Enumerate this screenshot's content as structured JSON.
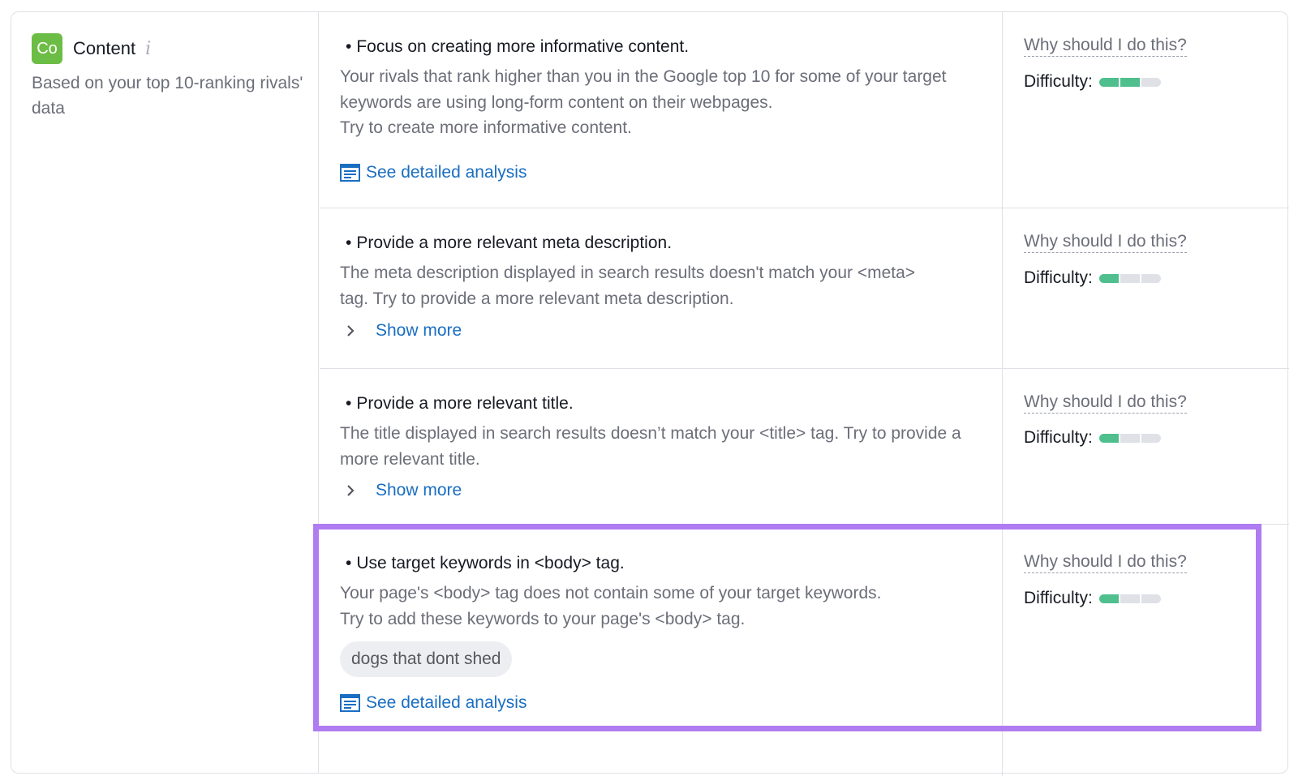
{
  "category": {
    "badge": "Co",
    "title": "Content",
    "info_icon": "info-icon",
    "description": "Based on your top 10-ranking rivals' data"
  },
  "colors": {
    "badge": "#6cbd45",
    "link": "#1a6ec2",
    "difficulty_fill": "#4fbf8e",
    "highlight": "#b07cf2"
  },
  "ideas": [
    {
      "title": "Focus on creating more informative content.",
      "description": "Your rivals that rank higher than you in the Google top 10 for some of your target keywords are using long-form content on their webpages.\nTry to create more informative content.",
      "link": "See detailed analysis",
      "why": "Why should I do this?",
      "difficulty_label": "Difficulty:",
      "difficulty_level": 2,
      "difficulty_max": 3
    },
    {
      "title": "Provide a more relevant meta description.",
      "description": "The meta description displayed in search results doesn't match your <meta> tag. Try to provide a more relevant meta description.",
      "link": "Show more",
      "why": "Why should I do this?",
      "difficulty_label": "Difficulty:",
      "difficulty_level": 1,
      "difficulty_max": 3
    },
    {
      "title": "Provide a more relevant title.",
      "description": "The title displayed in search results doesn’t match your <title> tag. Try to provide a more relevant title.",
      "link": "Show more",
      "why": "Why should I do this?",
      "difficulty_label": "Difficulty:",
      "difficulty_level": 1,
      "difficulty_max": 3
    },
    {
      "title": "Use target keywords in <body> tag.",
      "description": "Your page's <body> tag does not contain some of your target keywords.\nTry to add these keywords to your page's <body> tag.",
      "keyword": "dogs that dont shed",
      "link": "See detailed analysis",
      "why": "Why should I do this?",
      "difficulty_label": "Difficulty:",
      "difficulty_level": 1,
      "difficulty_max": 3
    }
  ]
}
